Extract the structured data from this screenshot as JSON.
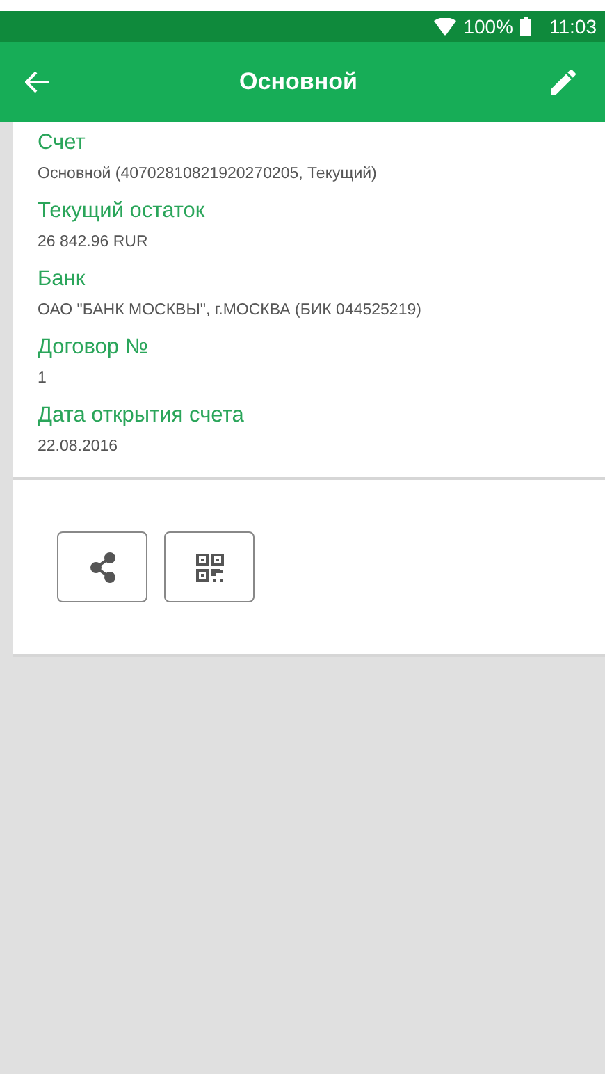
{
  "status_bar": {
    "battery": "100%",
    "time": "11:03"
  },
  "app_bar": {
    "title": "Основной"
  },
  "fields": [
    {
      "label": "Счет",
      "value": "Основной (40702810821920270205, Текущий)"
    },
    {
      "label": "Текущий остаток",
      "value": "26 842.96 RUR"
    },
    {
      "label": "Банк",
      "value": "ОАО \"БАНК МОСКВЫ\", г.МОСКВА (БИК 044525219)"
    },
    {
      "label": "Договор №",
      "value": "1"
    },
    {
      "label": "Дата открытия счета",
      "value": "22.08.2016"
    }
  ],
  "actions": [
    {
      "kind": "share"
    },
    {
      "kind": "qr"
    }
  ]
}
